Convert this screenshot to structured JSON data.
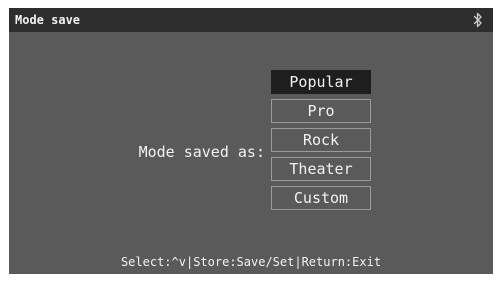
{
  "title_bar": {
    "title": "Mode save",
    "icon": "bluetooth-icon"
  },
  "main": {
    "prompt_label": "Mode saved as:",
    "modes": [
      {
        "label": "Popular",
        "selected": true
      },
      {
        "label": "Pro",
        "selected": false
      },
      {
        "label": "Rock",
        "selected": false
      },
      {
        "label": "Theater",
        "selected": false
      },
      {
        "label": "Custom",
        "selected": false
      }
    ]
  },
  "status_bar": {
    "hint": "Select:^v|Store:Save/Set|Return:Exit"
  },
  "colors": {
    "screen_bg": "#5a5a5a",
    "title_bar_bg": "#2e2e2e",
    "selected_bg": "#1e1e1e",
    "text": "#f2f2f2",
    "item_border": "#9a9a9a"
  }
}
